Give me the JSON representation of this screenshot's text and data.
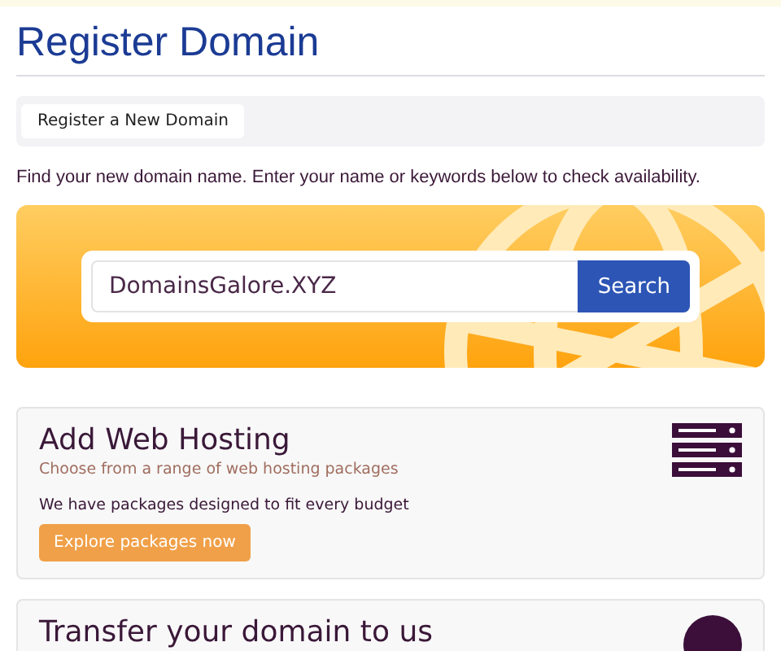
{
  "page": {
    "title": "Register Domain"
  },
  "tabs": [
    {
      "label": "Register a New Domain",
      "selected": true
    }
  ],
  "intro": "Find your new domain name. Enter your name or keywords below to check availability.",
  "search": {
    "value": "DomainsGalore.XYZ",
    "button": "Search"
  },
  "cards": [
    {
      "kind": "hosting",
      "title": "Add Web Hosting",
      "subtitle": "Choose from a range of web hosting packages",
      "body": "We have packages designed to fit every budget",
      "button": "Explore packages now"
    },
    {
      "kind": "transfer",
      "title": "Transfer your domain to us"
    }
  ]
}
